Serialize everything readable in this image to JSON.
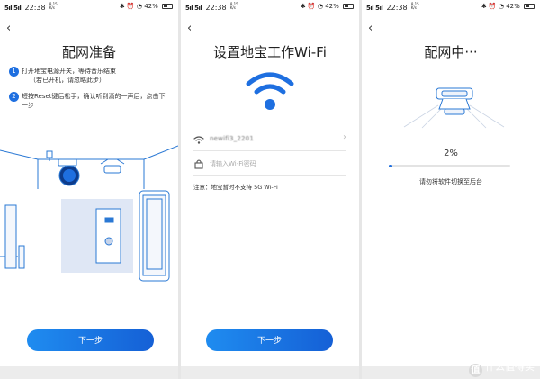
{
  "statusbar": {
    "signal": "5ıl 5ıl",
    "time": "22:38",
    "speed_top": "8.15",
    "speed_bottom": "K/s",
    "icons": "✱ ⏰ ◔",
    "battery": "42%"
  },
  "screen1": {
    "back": "‹",
    "title": "配网准备",
    "step1_num": "1",
    "step1_text": "打开地宝电源开关，等待音乐结束",
    "step1_sub": "（若已开机，请忽略此步）",
    "step2_num": "2",
    "step2_text": "短按Reset键后松手，确认听到滴的一声后，点击下一步",
    "next_button": "下一步"
  },
  "screen2": {
    "back": "‹",
    "title": "设置地宝工作Wi-Fi",
    "ssid_value": "newifi3_2201",
    "password_placeholder": "请输入Wi-Fi密码",
    "note": "注意：地宝暂时不支持 5G Wi-Fi",
    "next_button": "下一步"
  },
  "screen3": {
    "back": "‹",
    "title": "配网中···",
    "progress_percent": 2,
    "progress_label": "2%",
    "hint": "请勿将软件切换至后台"
  },
  "watermark": {
    "badge": "值",
    "text": "什么值得买"
  },
  "colors": {
    "accent": "#1e6fe0",
    "button_gradient_start": "#1f8cf0",
    "button_gradient_end": "#1560d6",
    "illustration_line": "#2a78d4",
    "illustration_fill": "#dfe7f5"
  }
}
